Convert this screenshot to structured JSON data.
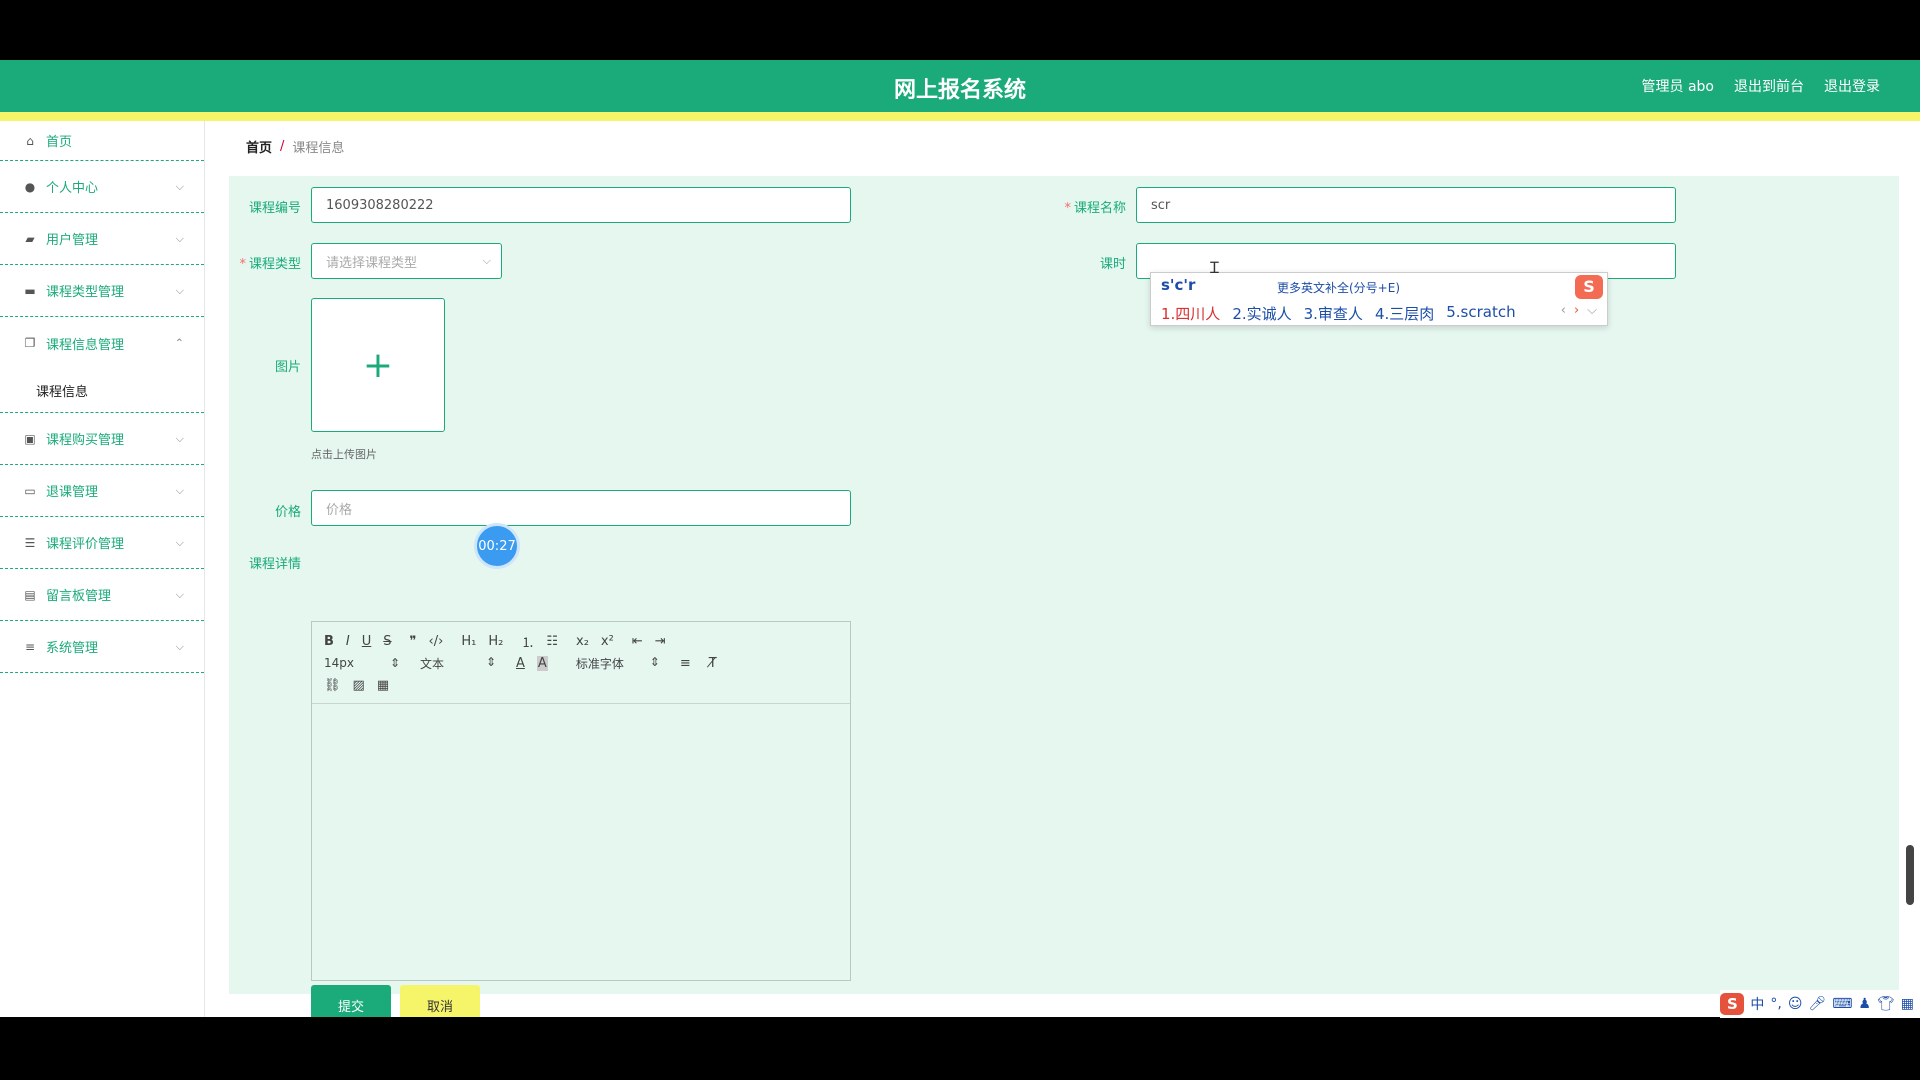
{
  "header": {
    "title": "网上报名系统",
    "user": "管理员 abo",
    "exit_front": "退出到前台",
    "logout": "退出登录"
  },
  "sidebar": {
    "items": [
      {
        "label": "首页",
        "icon": "home-icon"
      },
      {
        "label": "个人中心",
        "icon": "user-icon"
      },
      {
        "label": "用户管理",
        "icon": "users-icon"
      },
      {
        "label": "课程类型管理",
        "icon": "comment-icon"
      },
      {
        "label": "课程信息管理",
        "icon": "copy-icon"
      },
      {
        "label": "课程购买管理",
        "icon": "clipboard-icon"
      },
      {
        "label": "退课管理",
        "icon": "chat-icon"
      },
      {
        "label": "课程评价管理",
        "icon": "list-icon"
      },
      {
        "label": "留言板管理",
        "icon": "inbox-icon"
      },
      {
        "label": "系统管理",
        "icon": "sliders-icon"
      }
    ],
    "sub_item": "课程信息"
  },
  "breadcrumb": {
    "home": "首页",
    "sep": "/",
    "current": "课程信息"
  },
  "form": {
    "code_label": "课程编号",
    "code_value": "1609308280222",
    "name_label": "课程名称",
    "name_value": "scr",
    "type_label": "课程类型",
    "type_placeholder": "请选择课程类型",
    "hours_label": "课时",
    "image_label": "图片",
    "upload_hint": "点击上传图片",
    "price_label": "价格",
    "price_placeholder": "价格",
    "detail_label": "课程详情",
    "submit": "提交",
    "cancel": "取消"
  },
  "editor": {
    "font_size": "14px",
    "text_type": "文本",
    "font_family": "标准字体"
  },
  "timer": "00:27",
  "ime": {
    "composition": "s'c'r",
    "more": "更多英文补全(分号+E)",
    "candidates": [
      "1.四川人",
      "2.实诚人",
      "3.审查人",
      "4.三层肉",
      "5.scratch"
    ]
  },
  "tray": {
    "mode": "中"
  }
}
